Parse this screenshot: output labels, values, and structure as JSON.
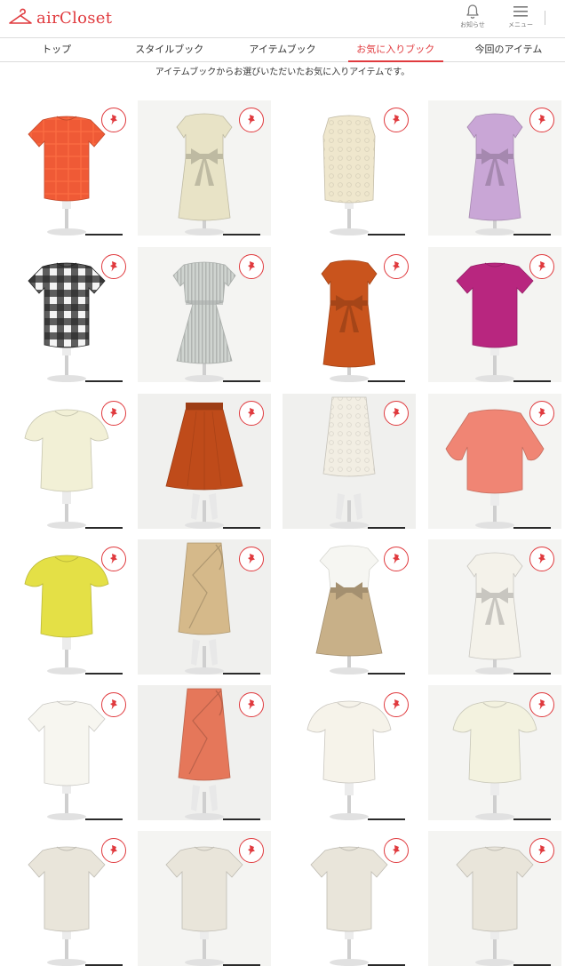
{
  "header": {
    "logo_text": "airCloset",
    "notify_label": "お知らせ",
    "menu_label": "メニュー",
    "accent_color": "#e03a3e"
  },
  "tabs": [
    {
      "label": "トップ",
      "active": false
    },
    {
      "label": "スタイルブック",
      "active": false
    },
    {
      "label": "アイテムブック",
      "active": false
    },
    {
      "label": "お気に入りブック",
      "active": true
    },
    {
      "label": "今回のアイテム",
      "active": false
    }
  ],
  "subtitle": "アイテムブックからお選びいただいたお気に入りアイテムです。",
  "items": [
    {
      "type": "top",
      "color": "#ef5a36",
      "pattern": "check",
      "bg": "#ffffff",
      "favorited": true
    },
    {
      "type": "dress-bow",
      "color": "#e8e3c6",
      "pattern": "none",
      "bg": "#f4f4f2",
      "favorited": true
    },
    {
      "type": "top-lace",
      "color": "#efe7cd",
      "pattern": "lace",
      "bg": "#ffffff",
      "favorited": true
    },
    {
      "type": "dress-bow",
      "color": "#c9a6d6",
      "pattern": "none",
      "bg": "#f4f4f2",
      "favorited": true
    },
    {
      "type": "top",
      "color": "#2b2b2b",
      "pattern": "gingham",
      "bg": "#ffffff",
      "favorited": true
    },
    {
      "type": "dress",
      "color": "#cfd4d0",
      "pattern": "stripe",
      "bg": "#f4f4f2",
      "favorited": true
    },
    {
      "type": "dress-bow",
      "color": "#c9541d",
      "pattern": "none",
      "bg": "#ffffff",
      "favorited": true
    },
    {
      "type": "top",
      "color": "#b8267f",
      "pattern": "none",
      "bg": "#f4f4f2",
      "favorited": true
    },
    {
      "type": "top-flutter",
      "color": "#f2f0d6",
      "pattern": "none",
      "bg": "#ffffff",
      "favorited": true
    },
    {
      "type": "skirt",
      "color": "#bf4b1a",
      "pattern": "none",
      "bg": "#f0f0ee",
      "favorited": true
    },
    {
      "type": "skirt-lace",
      "color": "#f2eee3",
      "pattern": "lace",
      "bg": "#f0f0ee",
      "favorited": true
    },
    {
      "type": "top-wide",
      "color": "#f08574",
      "pattern": "none",
      "bg": "#f4f4f2",
      "favorited": true
    },
    {
      "type": "top-flutter",
      "color": "#e4e046",
      "pattern": "none",
      "bg": "#ffffff",
      "favorited": true
    },
    {
      "type": "skirt-wrap",
      "color": "#d5b98a",
      "pattern": "none",
      "bg": "#f0f0ee",
      "favorited": true
    },
    {
      "type": "set",
      "color": "#c8b088",
      "pattern": "none",
      "bg": "#ffffff",
      "favorited": true
    },
    {
      "type": "dress-bow",
      "color": "#f4f2ea",
      "pattern": "none",
      "bg": "#f4f4f2",
      "favorited": true
    },
    {
      "type": "top",
      "color": "#f7f6f0",
      "pattern": "none",
      "bg": "#ffffff",
      "favorited": true
    },
    {
      "type": "skirt-wrap",
      "color": "#e5775a",
      "pattern": "none",
      "bg": "#f0f0ee",
      "favorited": true
    },
    {
      "type": "top-flutter",
      "color": "#f6f3ea",
      "pattern": "none",
      "bg": "#ffffff",
      "favorited": true
    },
    {
      "type": "top-flutter",
      "color": "#f3f2df",
      "pattern": "none",
      "bg": "#f4f4f2",
      "favorited": true
    },
    {
      "type": "top",
      "color": "#e9e5da",
      "pattern": "none",
      "bg": "#ffffff",
      "favorited": true
    },
    {
      "type": "top",
      "color": "#e9e5da",
      "pattern": "none",
      "bg": "#f4f4f2",
      "favorited": true
    },
    {
      "type": "top",
      "color": "#e9e5da",
      "pattern": "none",
      "bg": "#ffffff",
      "favorited": true
    },
    {
      "type": "top",
      "color": "#e9e5da",
      "pattern": "none",
      "bg": "#f4f4f2",
      "favorited": true
    }
  ]
}
